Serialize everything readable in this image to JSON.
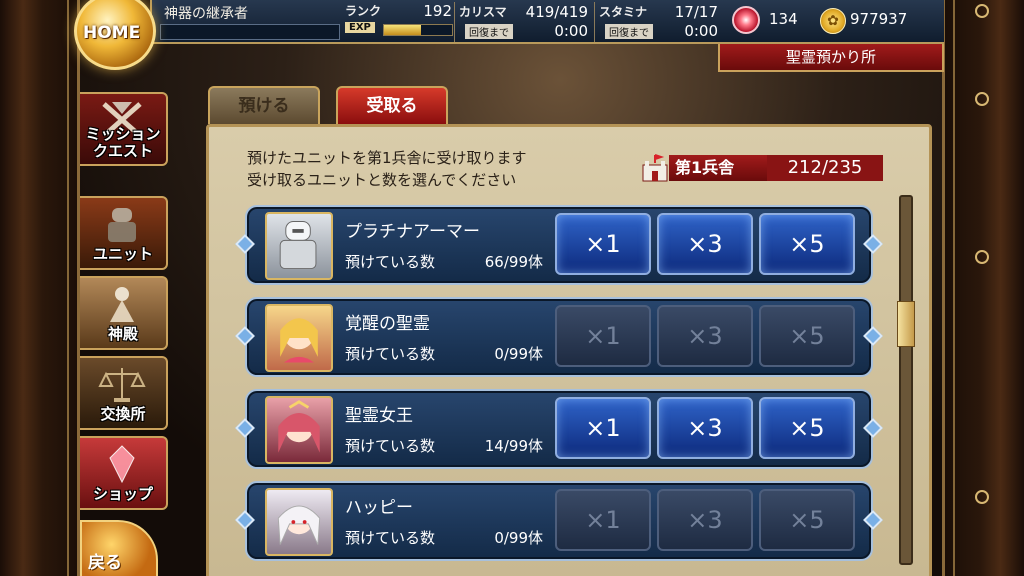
{
  "header": {
    "home_label": "HOME",
    "player_name": "神器の継承者",
    "rank_label": "ランク",
    "rank_value": "192",
    "exp_label": "EXP",
    "exp_progress": 0.55,
    "charisma_label": "カリスマ",
    "charisma_value": "419/419",
    "charisma_recover_label": "回復まで",
    "charisma_recover_time": "0:00",
    "stamina_label": "スタミナ",
    "stamina_value": "17/17",
    "stamina_recover_label": "回復まで",
    "stamina_recover_time": "0:00",
    "gems": "134",
    "gold": "977937"
  },
  "location": "聖霊預かり所",
  "nav": {
    "items": [
      {
        "label": "ミッション\nクエスト",
        "icon": "crossed-swords-icon"
      },
      {
        "label": "ユニット",
        "icon": "armor-icon"
      },
      {
        "label": "神殿",
        "icon": "goddess-icon"
      },
      {
        "label": "交換所",
        "icon": "scales-icon"
      },
      {
        "label": "ショップ",
        "icon": "crystal-icon"
      }
    ],
    "back_label": "戻る"
  },
  "tabs": [
    {
      "label": "預ける",
      "active": false
    },
    {
      "label": "受取る",
      "active": true
    }
  ],
  "panel": {
    "instruction_line1": "預けたユニットを第1兵舎に受け取ります",
    "instruction_line2": "受け取るユニットと数を選んでください",
    "barracks_name": "第1兵舎",
    "barracks_count": "212/235",
    "count_label": "預けている数",
    "units": [
      {
        "name": "プラチナアーマー",
        "count": "66/99体",
        "x1": "×1",
        "x3": "×3",
        "x5": "×5",
        "enabled": true
      },
      {
        "name": "覚醒の聖霊",
        "count": "0/99体",
        "x1": "×1",
        "x3": "×3",
        "x5": "×5",
        "enabled": false
      },
      {
        "name": "聖霊女王",
        "count": "14/99体",
        "x1": "×1",
        "x3": "×3",
        "x5": "×5",
        "enabled": true
      },
      {
        "name": "ハッピー",
        "count": "0/99体",
        "x1": "×1",
        "x3": "×3",
        "x5": "×5",
        "enabled": false
      }
    ]
  },
  "colors": {
    "accent_red": "#a11b1b",
    "gold": "#caa25c",
    "button_blue": "#2f63c8"
  }
}
